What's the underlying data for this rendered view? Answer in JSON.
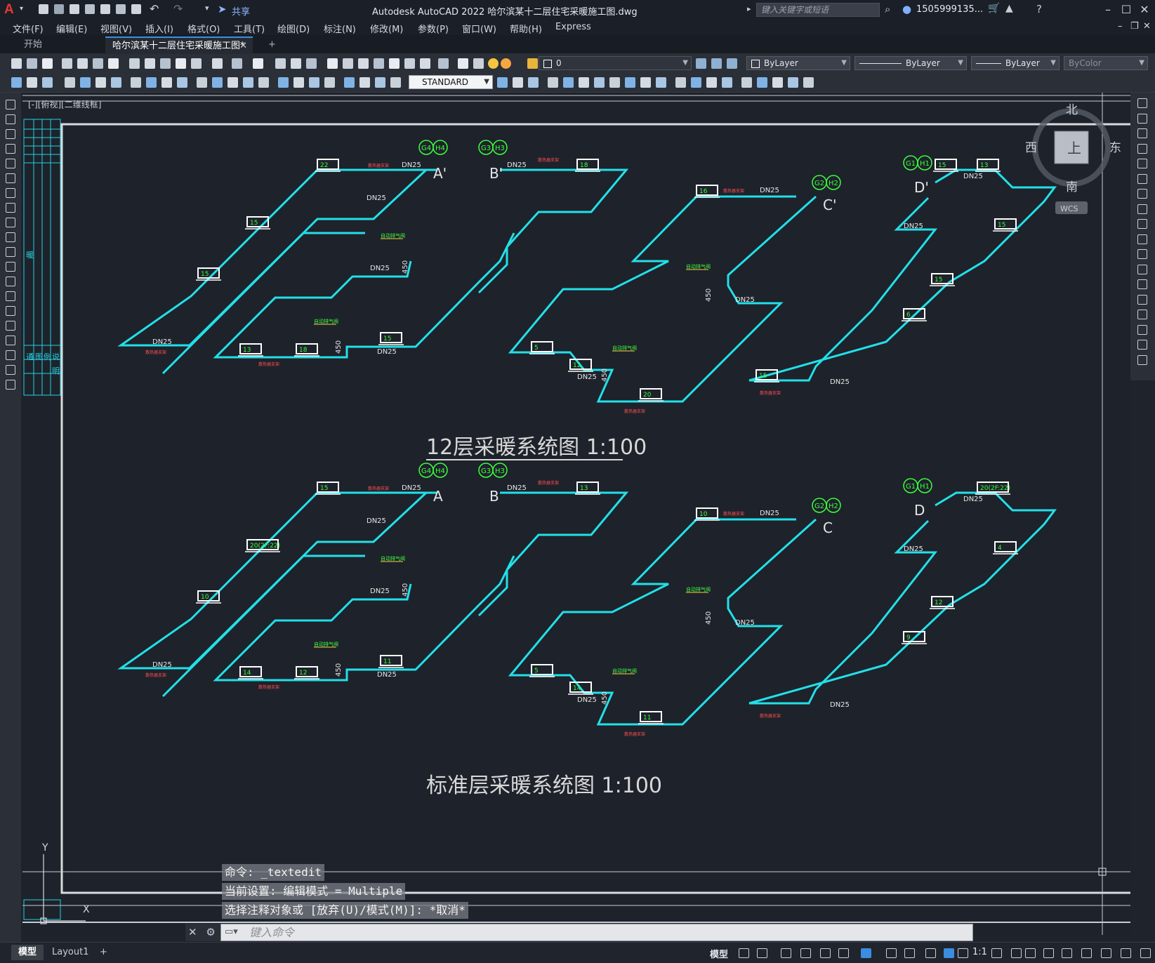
{
  "app": {
    "logo": "A",
    "title": "Autodesk AutoCAD 2022    哈尔滨某十二层住宅采暖施工图.dwg",
    "share": "共享",
    "search_placeholder": "键入关键字或短语",
    "user": "1505999135...",
    "window_controls": [
      "minimize-icon",
      "maximize-icon",
      "close-icon"
    ]
  },
  "menu": [
    "文件(F)",
    "编辑(E)",
    "视图(V)",
    "插入(I)",
    "格式(O)",
    "工具(T)",
    "绘图(D)",
    "标注(N)",
    "修改(M)",
    "参数(P)",
    "窗口(W)",
    "帮助(H)",
    "Express"
  ],
  "tabs": {
    "start": "开始",
    "document": "哈尔滨某十二层住宅采暖施工图*",
    "add": "+"
  },
  "toolbar": {
    "layer": "0",
    "color": "ByLayer",
    "linetype": "ByLayer",
    "lineweight": "ByLayer",
    "plotstyle": "ByColor",
    "textstyle": "STANDARD"
  },
  "viewport_label": "[-][俯视][二维线框]",
  "viewcube": {
    "north": "北",
    "south": "南",
    "east": "东",
    "west": "西",
    "top": "上",
    "wcs": "WCS"
  },
  "left_table": {
    "texts": [
      "暖",
      "通",
      "图",
      "例",
      "说",
      "明"
    ]
  },
  "drawing": {
    "title1": "12层采暖系统图 1:100",
    "title2": "标准层采暖系统图 1:100",
    "pipe_label": "DN25",
    "riser_label_450": "450",
    "air_vent_label": "自动排气阀",
    "note_label": "散热器支架",
    "risers_top": [
      {
        "labels": [
          "G4",
          "H4"
        ],
        "letter": "A'"
      },
      {
        "labels": [
          "G3",
          "H3"
        ],
        "letter": "B'"
      },
      {
        "labels": [
          "G2",
          "H2"
        ],
        "letter": "C'"
      },
      {
        "labels": [
          "G1",
          "H1"
        ],
        "letter": "D'"
      }
    ],
    "risers_bottom": [
      {
        "labels": [
          "G4",
          "H4"
        ],
        "letter": "A"
      },
      {
        "labels": [
          "G3",
          "H3"
        ],
        "letter": "B"
      },
      {
        "labels": [
          "G2",
          "H2"
        ],
        "letter": "C"
      },
      {
        "labels": [
          "G1",
          "H1"
        ],
        "letter": "D"
      }
    ],
    "radiators_top": [
      "22",
      "18",
      "15",
      "15",
      "13",
      "18",
      "15",
      "16",
      "13",
      "15",
      "15",
      "6",
      "12",
      "20",
      "5",
      "15",
      "15"
    ],
    "radiators_bottom": [
      "15",
      "13",
      "20(2F:22)",
      "10",
      "14",
      "12",
      "11",
      "10",
      "20(2F:22)",
      "4",
      "12",
      "9",
      "14",
      "11",
      "5"
    ]
  },
  "command": {
    "history": [
      "命令: _textedit",
      "当前设置: 编辑模式 = Multiple",
      "选择注释对象或 [放弃(U)/模式(M)]: *取消*"
    ],
    "prompt_placeholder": "键入命令"
  },
  "layout_tabs": [
    "模型",
    "Layout1",
    "+"
  ],
  "status": {
    "model": "模型",
    "scale": "1:1"
  }
}
